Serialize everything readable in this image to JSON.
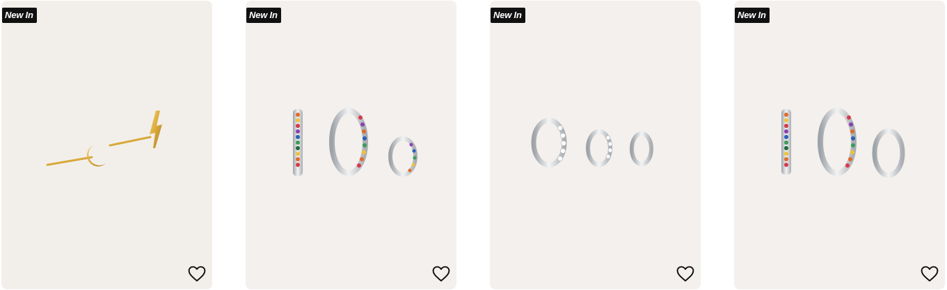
{
  "products": [
    {
      "badge": "New In",
      "image": "gold-moon-and-lightning-stud-earrings",
      "favorite_icon": "heart-outline-icon"
    },
    {
      "badge": "New In",
      "image": "silver-rainbow-hoop-earring-set",
      "favorite_icon": "heart-outline-icon"
    },
    {
      "badge": "New In",
      "image": "silver-crystal-huggie-hoop-set",
      "favorite_icon": "heart-outline-icon"
    },
    {
      "badge": "New In",
      "image": "silver-rainbow-and-plain-hoop-set",
      "favorite_icon": "heart-outline-icon"
    }
  ],
  "colors": {
    "card_bg": "#f3f0ed",
    "badge_bg": "#111111",
    "badge_text": "#ffffff",
    "gold": "#d9a93a",
    "silver": "#c9ccd0"
  }
}
